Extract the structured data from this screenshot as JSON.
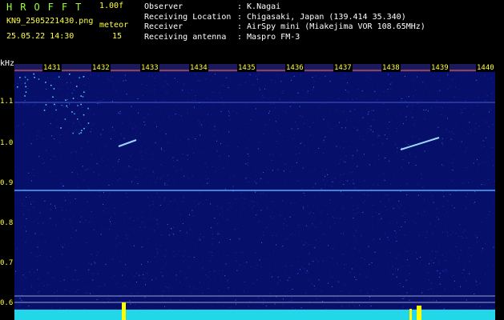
{
  "header": {
    "app_title": "HROFFT",
    "version": "1.00f",
    "filename": "KN9_2505221430.png",
    "mode": "meteor",
    "datetime": "25.05.22 14:30",
    "count": "15"
  },
  "info": [
    {
      "label": "Observer",
      "value": ": K.Nagai"
    },
    {
      "label": "Receiving Location",
      "value": ": Chigasaki, Japan (139.414 35.340)"
    },
    {
      "label": "Receiver",
      "value": ": AirSpy mini (Miakejima VOR 108.65MHz)"
    },
    {
      "label": "Receiving antenna",
      "value": ": Maspro FM-3"
    }
  ],
  "axis": {
    "unit": "kHz",
    "y_ticks": [
      "1.1",
      "1.0",
      "0.9",
      "0.8",
      "0.7",
      "0.6"
    ],
    "time_ticks": [
      "1431",
      "1432",
      "1433",
      "1434",
      "1435",
      "1436",
      "1437",
      "1438",
      "1439",
      "1440"
    ]
  },
  "colors": {
    "background": "#000000",
    "spectrogram": "#06106a",
    "header_text": "#ffff40",
    "title_text": "#9cff3a",
    "trace": "#9fd6ff",
    "signal_line": "#53a8ff",
    "peak": "#ffff00"
  }
}
